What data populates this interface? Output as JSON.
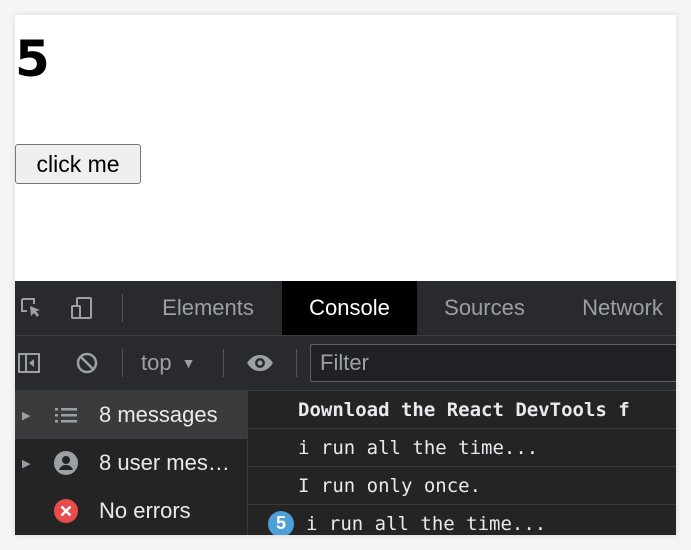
{
  "page": {
    "counter_value": "5",
    "button_label": "click me"
  },
  "devtools": {
    "tabs": [
      {
        "label": "Elements"
      },
      {
        "label": "Console"
      },
      {
        "label": "Sources"
      },
      {
        "label": "Network"
      }
    ],
    "active_tab": "Console",
    "toolbar": {
      "context": "top",
      "filter_placeholder": "Filter"
    },
    "sidebar": [
      {
        "label": "8 messages",
        "icon": "list-icon",
        "expandable": true,
        "selected": true
      },
      {
        "label": "8 user mes…",
        "icon": "user-icon",
        "expandable": true,
        "selected": false
      },
      {
        "label": "No errors",
        "icon": "error-icon",
        "expandable": false,
        "selected": false
      }
    ],
    "messages": [
      {
        "text": "Download the React DevTools f",
        "repeat": null
      },
      {
        "text": "i run all the time...",
        "repeat": null
      },
      {
        "text": "I run only once.",
        "repeat": null
      },
      {
        "text": "i run all the time...",
        "repeat": "5"
      }
    ]
  },
  "colors": {
    "devtools_bg": "#242424",
    "active_tab_bg": "#000000",
    "error_red": "#e94c4c",
    "repeat_badge": "#4f9fd9"
  }
}
